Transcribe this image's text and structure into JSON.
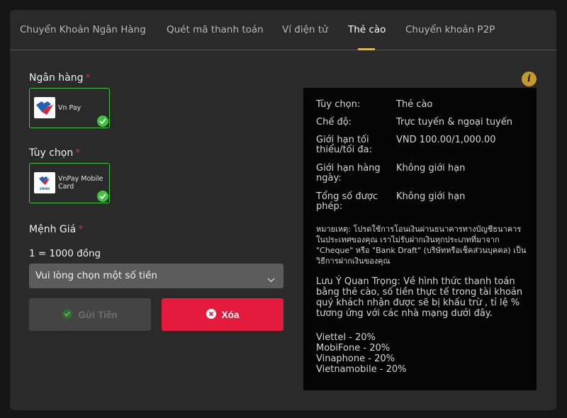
{
  "tabs": [
    {
      "label": "Chuyển Khoản Ngân Hàng"
    },
    {
      "label": "Quét mã thanh toán"
    },
    {
      "label": "Ví điện tử"
    },
    {
      "label": "Thẻ cào"
    },
    {
      "label": "Chuyển khoản P2P"
    }
  ],
  "form": {
    "bank_label": "Ngân hàng",
    "bank_card": "Vn Pay",
    "option_label": "Tùy chọn",
    "option_card": "VnPay Mobile Card",
    "option_logo_text": "VNPAY",
    "amount_label": "Mệnh Giá",
    "required_mark": "*",
    "rate_text": "1 = 1000 đồng",
    "select_placeholder": "Vui lòng chọn một số tiền",
    "send_label": "Gửi Tiền",
    "clear_label": "Xóa"
  },
  "info": {
    "rows": [
      {
        "k": "Tùy chọn:",
        "v": "Thẻ cào"
      },
      {
        "k": "Chế độ:",
        "v": "Trực tuyến & ngoại tuyến"
      },
      {
        "k": "Giới hạn tối thiểu/tối đa:",
        "v": "VND 100.00/1,000.00"
      },
      {
        "k": "Giới hạn hàng ngày:",
        "v": "Không giới hạn"
      },
      {
        "k": "Tổng số được phép:",
        "v": "Không giới hạn"
      }
    ],
    "note": "หมายเหตุ: โปรดใช้การโอนเงินผ่านธนาคารทางบัญชีธนาคารในประเทศของคุณ เราไม่รับฝากเงินทุกประเภทที่มาจาก \"Cheque\" หรือ \"Bank Draft\" (บริษัทหรือเช็คส่วนบุคคล) เป็นวิธีการฝากเงินของคุณ",
    "important": "Lưu Ý Quan Trọng: Về hình thức thanh toán bằng thẻ cào, số tiền thực tế trong tài khoản quý khách nhận được sẽ bị khấu trừ , tỉ lệ % tương ứng với các nhà mạng dưới đây.",
    "carriers": [
      "Viettel - 20%",
      "MobiFone - 20%",
      "Vinaphone - 20%",
      "Vietnamobile - 20%"
    ]
  }
}
